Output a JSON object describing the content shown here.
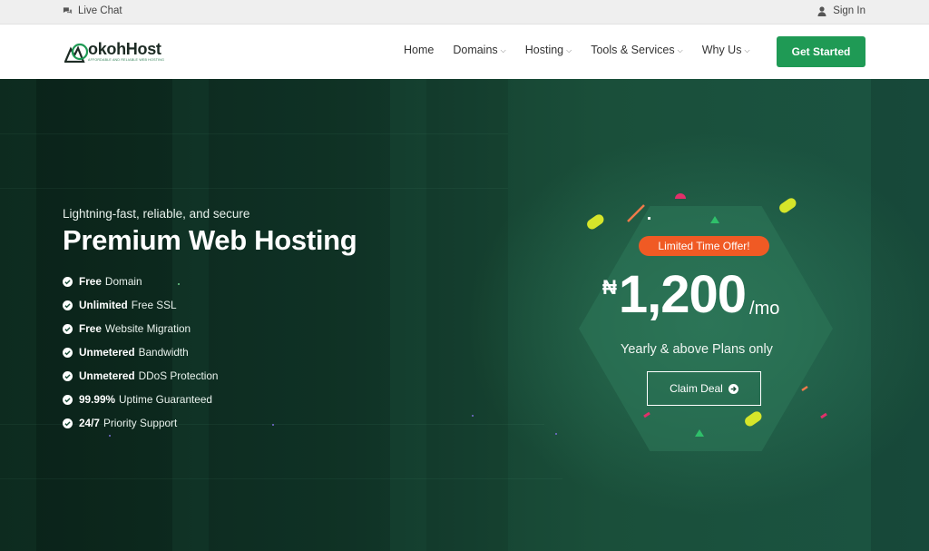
{
  "topbar": {
    "live_chat": "Live Chat",
    "chat_icon": "chat-bubbles-icon",
    "sign_in": "Sign In",
    "user_icon": "user-icon"
  },
  "nav": {
    "logo_text": "okohHost",
    "logo_tagline": "AFFORDABLE AND RELIABLE WEB HOSTING",
    "items": [
      {
        "label": "Home",
        "dropdown": false
      },
      {
        "label": "Domains",
        "dropdown": true
      },
      {
        "label": "Hosting",
        "dropdown": true
      },
      {
        "label": "Tools & Services",
        "dropdown": true
      },
      {
        "label": "Why Us",
        "dropdown": true
      }
    ],
    "cta": "Get Started"
  },
  "hero": {
    "lead": "Lightning-fast, reliable, and secure",
    "title": "Premium Web Hosting",
    "features": [
      {
        "bold": "Free",
        "rest": "Domain"
      },
      {
        "bold": "Unlimited",
        "rest": "Free SSL"
      },
      {
        "bold": "Free",
        "rest": "Website Migration"
      },
      {
        "bold": "Unmetered",
        "rest": "Bandwidth"
      },
      {
        "bold": "Unmetered",
        "rest": "DDoS Protection"
      },
      {
        "bold": "99.99%",
        "rest": "Uptime Guaranteed"
      },
      {
        "bold": "24/7",
        "rest": "Priority Support"
      }
    ]
  },
  "offer": {
    "badge": "Limited Time Offer!",
    "currency": "₦",
    "price": "1,200",
    "period": "/mo",
    "subtitle": "Yearly & above Plans only",
    "button": "Claim Deal",
    "button_icon": "arrow-circle-right-icon"
  },
  "colors": {
    "accent_green": "#1f9a55",
    "badge_orange": "#f05a24",
    "hero_dark": "#0f3324"
  }
}
